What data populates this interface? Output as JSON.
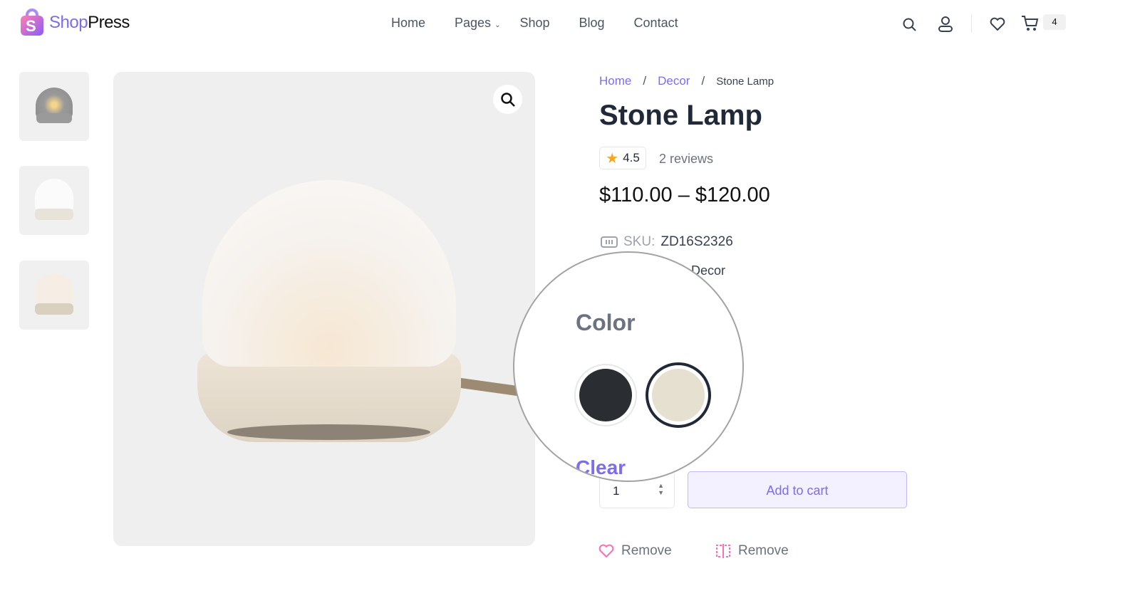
{
  "brand": {
    "part1": "Shop",
    "part2": "Press"
  },
  "nav": {
    "items": [
      {
        "label": "Home"
      },
      {
        "label": "Pages"
      },
      {
        "label": "Shop"
      },
      {
        "label": "Blog"
      },
      {
        "label": "Contact"
      }
    ]
  },
  "header": {
    "cart_count": "4",
    "icons": [
      "search-icon",
      "user-icon",
      "heart-icon",
      "cart-icon"
    ]
  },
  "breadcrumb": {
    "home": "Home",
    "sep": "/",
    "category": "Decor",
    "current": "Stone Lamp"
  },
  "product": {
    "title": "Stone Lamp",
    "rating": "4.5",
    "reviews": "2 reviews",
    "price": "$110.00 – $120.00",
    "sku_label": "SKU:",
    "sku": "ZD16S2326",
    "category": "Decor",
    "color_label": "Color",
    "colors": [
      "#2a2d31",
      "#e6e0d0"
    ],
    "selected_color": 1,
    "clear": "Clear",
    "quantity": "1",
    "add_to_cart": "Add to cart",
    "wishlist": "Remove",
    "compare": "Remove"
  },
  "colors": {
    "accent": "#7c6cf0",
    "wishlist": "#f472b6"
  }
}
